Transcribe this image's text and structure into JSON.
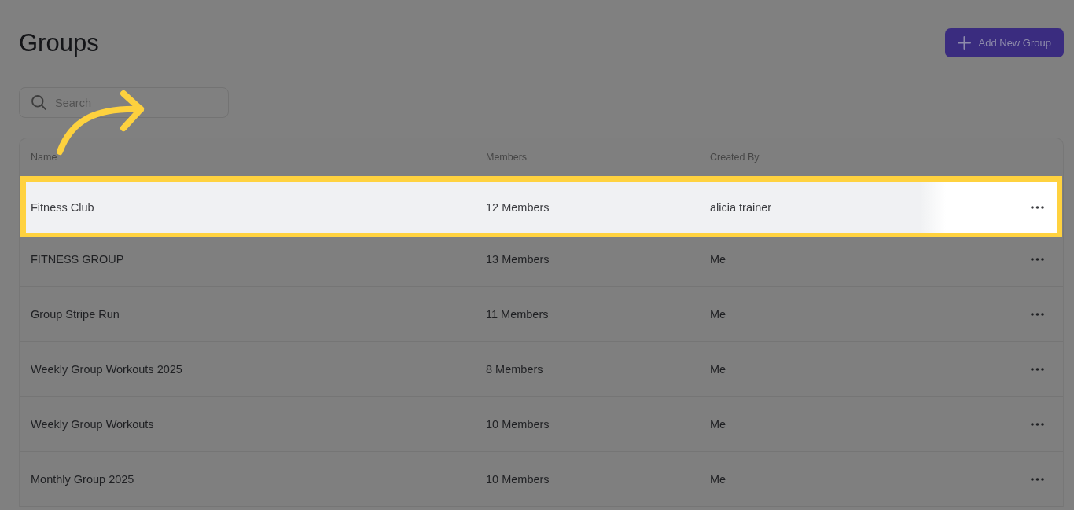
{
  "header": {
    "title": "Groups",
    "add_button": {
      "label": "Add New Group"
    }
  },
  "search": {
    "placeholder": "Search"
  },
  "table": {
    "columns": [
      "Name",
      "Members",
      "Created By"
    ],
    "rows": [
      {
        "name": "Fitness Club",
        "members": "12 Members",
        "created_by": "alicia trainer",
        "highlighted": true
      },
      {
        "name": "FITNESS GROUP",
        "members": "13 Members",
        "created_by": "Me",
        "highlighted": false
      },
      {
        "name": "Group Stripe Run",
        "members": "11 Members",
        "created_by": "Me",
        "highlighted": false
      },
      {
        "name": "Weekly Group Workouts 2025",
        "members": "8 Members",
        "created_by": "Me",
        "highlighted": false
      },
      {
        "name": "Weekly Group Workouts",
        "members": "10 Members",
        "created_by": "Me",
        "highlighted": false
      },
      {
        "name": "Monthly Group 2025",
        "members": "10 Members",
        "created_by": "Me",
        "highlighted": false
      }
    ]
  }
}
